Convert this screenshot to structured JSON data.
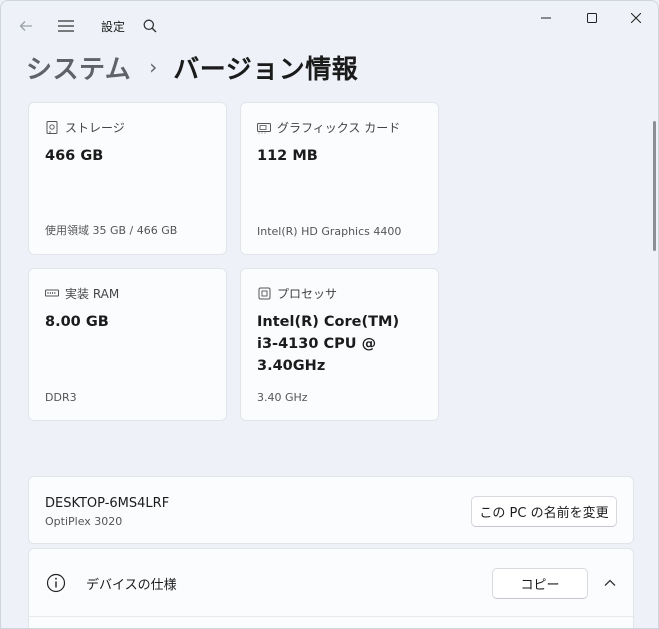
{
  "app": {
    "title": "設定"
  },
  "header": {
    "parent": "システム",
    "separator": "›",
    "current": "バージョン情報"
  },
  "cards": [
    {
      "label": "ストレージ",
      "value": "466 GB",
      "foot": "使用領域 35 GB / 466 GB",
      "icon": "storage-icon"
    },
    {
      "label": "グラフィックス カード",
      "value": "112 MB",
      "foot": "Intel(R) HD Graphics 4400",
      "icon": "graphics-card-icon"
    },
    {
      "label": "実装 RAM",
      "value": "8.00 GB",
      "foot": "DDR3",
      "icon": "ram-icon"
    },
    {
      "label": "プロセッサ",
      "value_lines": [
        "Intel(R) Core(TM)",
        "i3-4130 CPU @",
        "3.40GHz"
      ],
      "foot": "3.40 GHz",
      "icon": "processor-icon"
    }
  ],
  "device": {
    "name": "DESKTOP-6MS4LRF",
    "model": "OptiPlex 3020",
    "rename_label": "この PC の名前を変更"
  },
  "specs": {
    "title": "デバイスの仕様",
    "copy_label": "コピー"
  }
}
